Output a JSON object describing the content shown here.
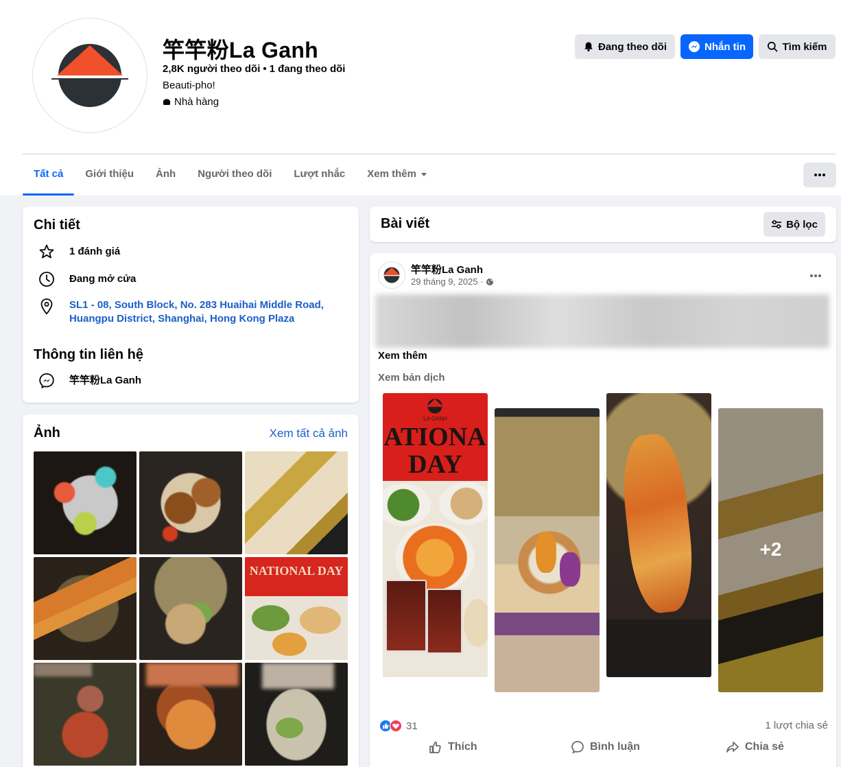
{
  "colors": {
    "accent": "#0866ff",
    "link": "#1a5fc8",
    "logo_dark": "#2c3136",
    "logo_orange": "#f0502a"
  },
  "page": {
    "name": "竿竿粉La Ganh",
    "followers": "2,8K người theo dõi",
    "following": "1 đang theo dõi",
    "bio": "Beauti-pho!",
    "category": "Nhà hàng"
  },
  "buttons": {
    "following": "Đang theo dõi",
    "message": "Nhắn tin",
    "search": "Tìm kiếm"
  },
  "tabs": [
    "Tất cả",
    "Giới thiệu",
    "Ảnh",
    "Người theo dõi",
    "Lượt nhắc",
    "Xem thêm"
  ],
  "details": {
    "title": "Chi tiết",
    "rating": "1 đánh giá",
    "hours": "Đang mở cửa",
    "address_line1": "SL1 - 08, South Block, No. 283 Huaihai Middle Road,",
    "address_line2": "Huangpu District, Shanghai, Hong Kong Plaza",
    "contact_title": "Thông tin liên hệ",
    "messenger": "竿竿粉La Ganh"
  },
  "photos": {
    "title": "Ảnh",
    "see_all": "Xem tất cả ảnh",
    "tile3_text": "NATIONAL DAY"
  },
  "posts": {
    "title": "Bài viết",
    "filter": "Bộ lọc"
  },
  "post": {
    "author": "竿竿粉La Ganh",
    "date": "29 tháng 9, 2025 · ",
    "see_more": "Xem thêm",
    "see_translation": "Xem bản dịch",
    "poster_brand": "LA GANH",
    "poster_line1": "ATIONA",
    "poster_line2": "DAY",
    "extra_count": "+2",
    "reactions": "31",
    "shares": "1 lượt chia sẻ",
    "like": "Thích",
    "comment": "Bình luận",
    "share": "Chia sẻ"
  }
}
